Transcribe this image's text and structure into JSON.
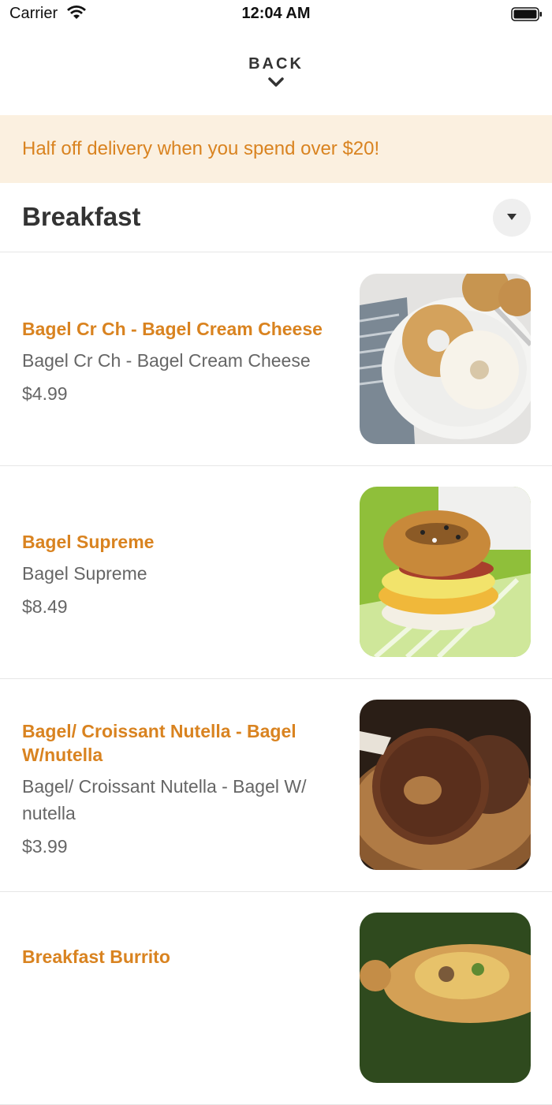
{
  "status_bar": {
    "carrier": "Carrier",
    "time": "12:04 AM"
  },
  "nav": {
    "back_label": "BACK"
  },
  "promo": {
    "text": "Half off delivery when you spend over $20!"
  },
  "section": {
    "title": "Breakfast"
  },
  "items": [
    {
      "name": "Bagel Cr Ch - Bagel Cream Cheese",
      "description": "Bagel Cr Ch - Bagel Cream Cheese",
      "price": "$4.99"
    },
    {
      "name": "Bagel Supreme",
      "description": "Bagel Supreme",
      "price": "$8.49"
    },
    {
      "name": "Bagel/ Croissant Nutella - Bagel W/nutella",
      "description": "Bagel/ Croissant Nutella - Bagel W/ nutella",
      "price": "$3.99"
    },
    {
      "name": "Breakfast Burrito",
      "description": "",
      "price": ""
    }
  ],
  "colors": {
    "accent": "#d98320",
    "promo_bg": "#fbf0e0",
    "text": "#333333",
    "muted": "#666666"
  }
}
